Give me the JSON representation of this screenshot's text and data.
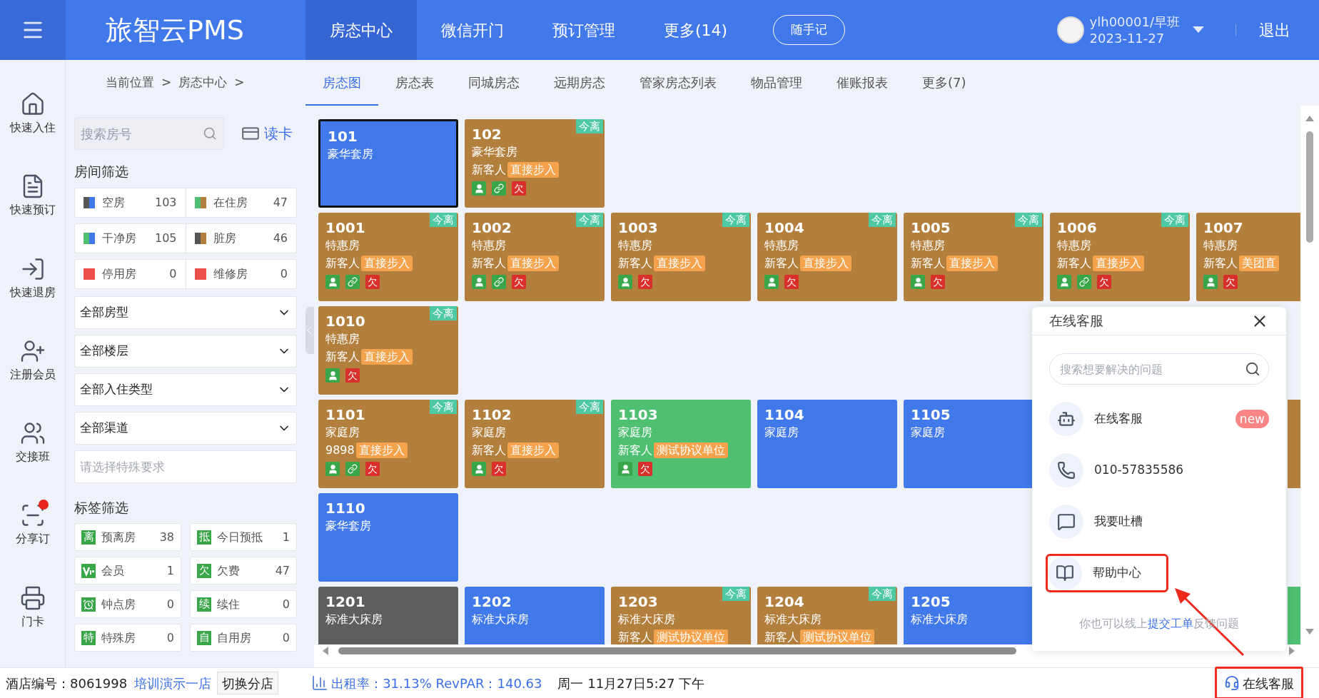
{
  "header": {
    "brand": "旅智云PMS",
    "nav": [
      {
        "label": "房态中心",
        "selected": true
      },
      {
        "label": "微信开门",
        "selected": false
      },
      {
        "label": "预订管理",
        "selected": false
      },
      {
        "label": "更多(14)",
        "selected": false
      }
    ],
    "note_button": "随手记",
    "user": {
      "name": "ylh00001/早班",
      "date": "2023-11-27"
    },
    "logout": "退出"
  },
  "breadcrumb": [
    "当前位置",
    ">",
    "房态中心",
    ">"
  ],
  "tabs": [
    {
      "label": "房态图",
      "selected": true
    },
    {
      "label": "房态表",
      "selected": false
    },
    {
      "label": "同城房态",
      "selected": false
    },
    {
      "label": "远期房态",
      "selected": false
    },
    {
      "label": "管家房态列表",
      "selected": false
    },
    {
      "label": "物品管理",
      "selected": false
    },
    {
      "label": "催账报表",
      "selected": false
    },
    {
      "label": "更多(7)",
      "selected": false
    }
  ],
  "sidebar": [
    {
      "kind": "checkin",
      "label": "快速入住",
      "dot": false
    },
    {
      "kind": "booking",
      "label": "快速预订",
      "dot": false
    },
    {
      "kind": "checkout",
      "label": "快速退房",
      "dot": false
    },
    {
      "kind": "member",
      "label": "注册会员",
      "dot": false
    },
    {
      "kind": "handover",
      "label": "交接班",
      "dot": false
    },
    {
      "kind": "share",
      "label": "分享订",
      "dot": true
    },
    {
      "kind": "card",
      "label": "门卡",
      "dot": false
    }
  ],
  "filter": {
    "search_placeholder": "搜索房号",
    "read_card": "读卡",
    "room_heading": "房间筛选",
    "room_stats": [
      {
        "label": "空房",
        "count": "103",
        "swatch": [
          {
            "color": "#555555"
          },
          {
            "color": "#4178ea"
          }
        ]
      },
      {
        "label": "在住房",
        "count": "47",
        "swatch": [
          {
            "color": "#4fbf72"
          },
          {
            "color": "#b37f3c"
          }
        ]
      },
      {
        "label": "干净房",
        "count": "105",
        "swatch": [
          {
            "color": "#4fbf72"
          },
          {
            "color": "#4178ea"
          }
        ]
      },
      {
        "label": "脏房",
        "count": "46",
        "swatch": [
          {
            "color": "#555555"
          },
          {
            "color": "#b37f3c"
          }
        ]
      },
      {
        "label": "停用房",
        "count": "0",
        "swatch": [
          {
            "color": "#ea4f4a"
          }
        ]
      },
      {
        "label": "维修房",
        "count": "0",
        "swatch": [
          {
            "color": "#ea4f4a"
          }
        ]
      }
    ],
    "selects": [
      "全部房型",
      "全部楼层",
      "全部入住类型",
      "全部渠道"
    ],
    "special_placeholder": "请选择特殊要求",
    "tag_heading": "标签筛选",
    "tags": [
      {
        "kind": "text",
        "badge": "离",
        "label": "预离房",
        "count": "38"
      },
      {
        "kind": "text",
        "badge": "抵",
        "label": "今日预抵",
        "count": "1"
      },
      {
        "kind": "vip",
        "label": "会员",
        "count": "1"
      },
      {
        "kind": "text",
        "badge": "欠",
        "label": "欠费",
        "count": "47"
      },
      {
        "kind": "clock",
        "label": "钟点房",
        "count": "0"
      },
      {
        "kind": "text",
        "badge": "续",
        "label": "续住",
        "count": "0"
      },
      {
        "kind": "text",
        "badge": "特",
        "label": "特殊房",
        "count": "0"
      },
      {
        "kind": "text",
        "badge": "自",
        "label": "自用房",
        "count": "0"
      }
    ]
  },
  "room_rows": [
    {
      "rooms": [
        {
          "number": "101",
          "type": "豪华套房",
          "color": "#4178ea",
          "selected": true
        },
        {
          "number": "102",
          "type": "豪华套房",
          "color": "#b37f3c",
          "selected": false,
          "leaving": "今离",
          "guest": "新客人",
          "tag": "直接步入",
          "marks": [
            {
              "kind": "guest"
            },
            {
              "kind": "link"
            },
            {
              "kind": "debt",
              "text": "欠"
            }
          ]
        }
      ]
    },
    {
      "rooms": [
        {
          "number": "1001",
          "type": "特惠房",
          "color": "#b37f3c",
          "selected": false,
          "leaving": "今离",
          "guest": "新客人",
          "tag": "直接步入",
          "marks": [
            {
              "kind": "guest"
            },
            {
              "kind": "link"
            },
            {
              "kind": "debt",
              "text": "欠"
            }
          ]
        },
        {
          "number": "1002",
          "type": "特惠房",
          "color": "#b37f3c",
          "selected": false,
          "leaving": "今离",
          "guest": "新客人",
          "tag": "直接步入",
          "marks": [
            {
              "kind": "guest"
            },
            {
              "kind": "link"
            },
            {
              "kind": "debt",
              "text": "欠"
            }
          ]
        },
        {
          "number": "1003",
          "type": "特惠房",
          "color": "#b37f3c",
          "selected": false,
          "leaving": "今离",
          "guest": "新客人",
          "tag": "直接步入",
          "marks": [
            {
              "kind": "guest"
            },
            {
              "kind": "debt",
              "text": "欠"
            }
          ]
        },
        {
          "number": "1004",
          "type": "特惠房",
          "color": "#b37f3c",
          "selected": false,
          "leaving": "今离",
          "guest": "新客人",
          "tag": "直接步入",
          "marks": [
            {
              "kind": "guest"
            },
            {
              "kind": "debt",
              "text": "欠"
            }
          ]
        },
        {
          "number": "1005",
          "type": "特惠房",
          "color": "#b37f3c",
          "selected": false,
          "leaving": "今离",
          "guest": "新客人",
          "tag": "直接步入",
          "marks": [
            {
              "kind": "guest"
            },
            {
              "kind": "debt",
              "text": "欠"
            }
          ]
        },
        {
          "number": "1006",
          "type": "特惠房",
          "color": "#b37f3c",
          "selected": false,
          "leaving": "今离",
          "guest": "新客人",
          "tag": "直接步入",
          "marks": [
            {
              "kind": "guest"
            },
            {
              "kind": "link"
            },
            {
              "kind": "debt",
              "text": "欠"
            }
          ]
        },
        {
          "number": "1007",
          "type": "特惠房",
          "color": "#b37f3c",
          "selected": false,
          "guest": "新客人",
          "tag": "美团直",
          "marks": [
            {
              "kind": "guest"
            },
            {
              "kind": "debt",
              "text": "欠"
            }
          ]
        }
      ]
    },
    {
      "rooms": [
        {
          "number": "1010",
          "type": "特惠房",
          "color": "#b37f3c",
          "selected": false,
          "leaving": "今离",
          "guest": "新客人",
          "tag": "直接步入",
          "marks": [
            {
              "kind": "guest"
            },
            {
              "kind": "debt",
              "text": "欠"
            }
          ]
        }
      ]
    },
    {
      "rooms": [
        {
          "number": "1101",
          "type": "家庭房",
          "color": "#b37f3c",
          "selected": false,
          "leaving": "今离",
          "guest": "9898",
          "tag": "直接步入",
          "marks": [
            {
              "kind": "guest"
            },
            {
              "kind": "link"
            },
            {
              "kind": "debt",
              "text": "欠"
            }
          ]
        },
        {
          "number": "1102",
          "type": "家庭房",
          "color": "#b37f3c",
          "selected": false,
          "leaving": "今离",
          "guest": "新客人",
          "tag": "直接步入",
          "marks": [
            {
              "kind": "guest"
            },
            {
              "kind": "debt",
              "text": "欠"
            }
          ]
        },
        {
          "number": "1103",
          "type": "家庭房",
          "color": "#4fbf72",
          "selected": false,
          "guest": "新客人",
          "tag": "测试协议单位",
          "marks": [
            {
              "kind": "guest"
            },
            {
              "kind": "debt",
              "text": "欠"
            }
          ]
        },
        {
          "number": "1104",
          "type": "家庭房",
          "color": "#4178ea",
          "selected": false
        },
        {
          "number": "1105",
          "type": "家庭房",
          "color": "#4178ea",
          "selected": false
        }
      ],
      "edge": {
        "color": "#b37f3c"
      }
    },
    {
      "rooms": [
        {
          "number": "1110",
          "type": "豪华套房",
          "color": "#4178ea",
          "selected": false
        }
      ]
    },
    {
      "rooms": [
        {
          "number": "1201",
          "type": "标准大床房",
          "color": "#5e5e5e",
          "selected": false
        },
        {
          "number": "1202",
          "type": "标准大床房",
          "color": "#4178ea",
          "selected": false
        },
        {
          "number": "1203",
          "type": "标准大床房",
          "color": "#b37f3c",
          "selected": false,
          "leaving": "今离",
          "guest": "新客人",
          "tag": "测试协议单位"
        },
        {
          "number": "1204",
          "type": "标准大床房",
          "color": "#b37f3c",
          "selected": false,
          "leaving": "今离",
          "guest": "新客人",
          "tag": "测试协议单位"
        },
        {
          "number": "1205",
          "type": "标准大床房",
          "color": "#4178ea",
          "selected": false
        }
      ],
      "edge": {
        "color": "#4fbf72"
      }
    }
  ],
  "support_panel": {
    "title": "在线客服",
    "search_placeholder": "搜索想要解决的问题",
    "items": [
      {
        "kind": "robot",
        "label": "在线客服",
        "badge": "new",
        "highlighted": false
      },
      {
        "kind": "phone",
        "label": "010-57835586",
        "highlighted": false
      },
      {
        "kind": "feedback",
        "label": "我要吐槽",
        "highlighted": false
      },
      {
        "kind": "help",
        "label": "帮助中心",
        "highlighted": true
      }
    ],
    "footer_before": "你也可以线上",
    "footer_link": "提交工单",
    "footer_after": "反馈问题",
    "arrow": true
  },
  "status_bar": {
    "hotel": "酒店编号：8061998",
    "hotel_name": "培训演示一店",
    "switch": "切换分店",
    "occupancy": "出租率：31.13% RevPAR：140.63",
    "datetime": "周一 11月27日5:27 下午",
    "support": "在线客服",
    "highlighted": true
  }
}
